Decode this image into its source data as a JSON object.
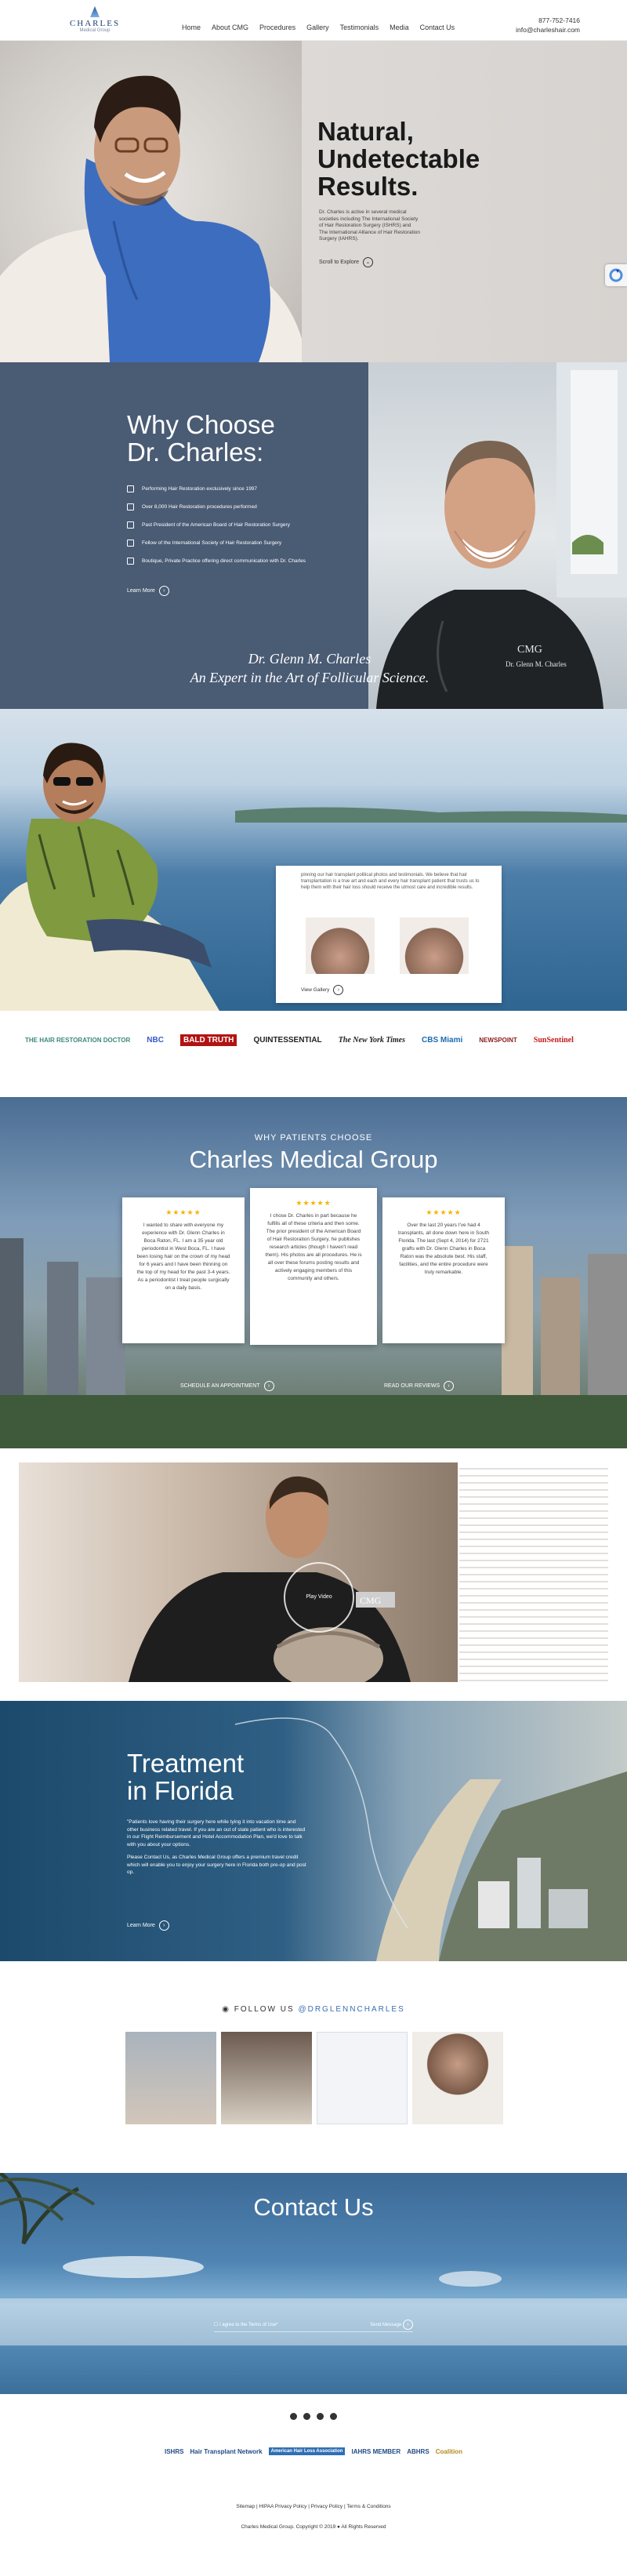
{
  "header": {
    "logo_text": "CHARLES",
    "logo_sub": "Medical Group",
    "nav": [
      "Home",
      "About CMG",
      "Procedures",
      "Gallery",
      "Testimonials",
      "Media",
      "Contact Us"
    ],
    "phone": "877-752-7416",
    "email": "info@charleshair.com"
  },
  "hero": {
    "heading_lines": [
      "Natural,",
      "Undetectable",
      "Results."
    ],
    "body": "Dr. Charles is active in several medical societies including The International Society of Hair Restoration Surgery (ISHRS) and The International Alliance of Hair Restoration Surgery (IAHRS).",
    "scroll_label": "Scroll to Explore"
  },
  "why": {
    "heading_lines": [
      "Why Choose",
      "Dr. Charles:"
    ],
    "items": [
      "Performing Hair Restoration exclusively since 1997",
      "Over 8,000 Hair Restoration procedures performed",
      "Past President of the American Board of Hair Restoration Surgery",
      "Fellow of the International Society of Hair Restoration Surgery",
      "Boutique, Private Practice offering direct communication with Dr. Charles"
    ],
    "learn_more": "Learn More",
    "caption_lines": [
      "Dr. Glenn M. Charles",
      "An Expert in the Art of Follicular Science."
    ],
    "badge": "CMG",
    "embroidery": "Dr. Glenn M. Charles"
  },
  "beach": {
    "body": "pinning our hair transplant political photos and testimonials. We believe that hair transplantation is a true art and each and every hair transplant patient that trusts us to help them with their hair loss should receive the utmost care and incredible results.",
    "view_gallery": "View Gallery"
  },
  "press": [
    "THE HAIR RESTORATION DOCTOR",
    "NBC",
    "BALD TRUTH",
    "QUINTESSENTIAL",
    "The New York Times",
    "CBS Miami",
    "NEWSPOINT",
    "SunSentinel"
  ],
  "patients": {
    "subheading": "WHY PATIENTS CHOOSE",
    "heading": "Charles Medical Group",
    "stars": "★★★★★",
    "reviews": [
      "I wanted to share with everyone my experience with Dr. Glenn Charles in Boca Raton, FL. I am a 35 year old periodontist in West Boca, FL. I have been losing hair on the crown of my head for 6 years and I have been thinning on the top of my head for the past 3-4 years. As a periodontist I treat people surgically on a daily basis.",
      "I chose Dr. Charles in part because he fulfills all of these criteria and then some. The prior president of the American Board of Hair Restoration Surgery, he publishes research articles (though I haven't read them). His photos are all procedures. He is all over these forums posting results and actively engaging members of this community and others.",
      "Over the last 20 years I've had 4 transplants, all done down here in South Florida. The last (Sept 4, 2014) for 2721 grafts with Dr. Glenn Charles in Boca Raton was the absolute best. His staff, facilities, and the entire procedure were truly remarkable."
    ],
    "schedule": "SCHEDULE AN APPOINTMENT",
    "read_reviews": "READ OUR REVIEWS"
  },
  "video": {
    "play_label": "Play Video",
    "badge": "CMG"
  },
  "florida": {
    "heading_lines": [
      "Treatment",
      "in Florida"
    ],
    "paragraphs": [
      "\"Patients love having their surgery here while tying it into vacation time and other business related travel. If you are an out of state patient who is interested in our Flight Reimbursement and Hotel Accommodation Plan, we'd love to talk with you about your options.",
      "Please Contact Us, as Charles Medical Group offers a premium travel credit which will enable you to enjoy your surgery here in Florida both pre-op and post op."
    ],
    "learn_more": "Learn More"
  },
  "follow": {
    "prefix": "FOLLOW US",
    "handle": "@DRGLENNCHARLES"
  },
  "contact": {
    "heading": "Contact Us",
    "terms": "I agree to the Terms of Use*",
    "send": "Send Message"
  },
  "footer": {
    "associations": [
      "ISHRS",
      "Hair Transplant Network",
      "American Hair Loss Association",
      "IAHRS MEMBER",
      "ABHRS",
      "Coalition"
    ],
    "links": "Sitemap | HIPAA Privacy Policy | Privacy Policy | Terms & Conditions",
    "copyright": "Charles Medical Group. Copyright © 2019 ● All Rights Reserved"
  },
  "colors": {
    "navy": "#4a5b74",
    "accent": "#3b6fb0",
    "star": "#f4b400"
  }
}
